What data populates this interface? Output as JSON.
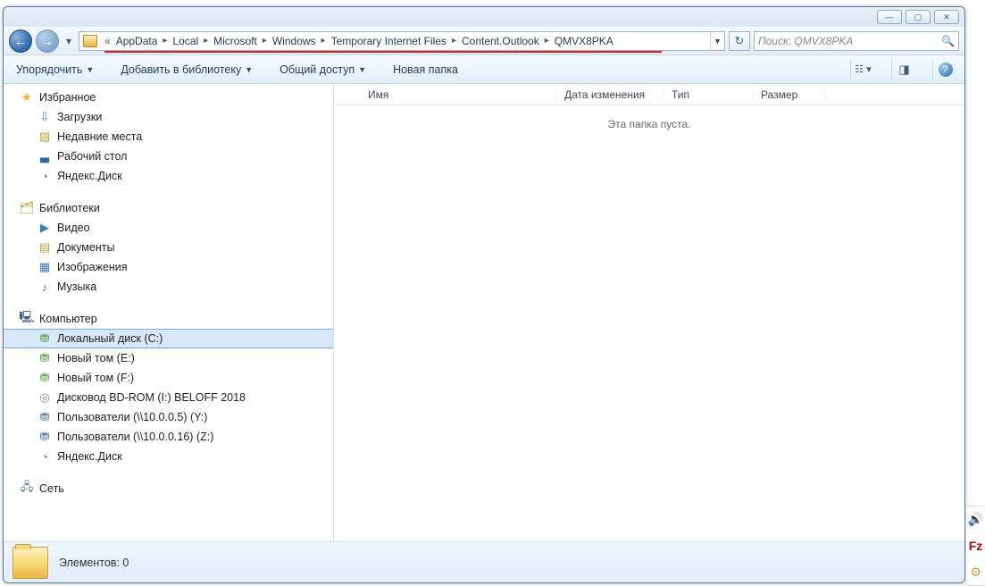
{
  "breadcrumbs": {
    "prefix": "«",
    "items": [
      "AppData",
      "Local",
      "Microsoft",
      "Windows",
      "Temporary Internet Files",
      "Content.Outlook",
      "QMVX8PKA"
    ]
  },
  "search": {
    "placeholder": "Поиск: QMVX8PKA"
  },
  "commands": {
    "organize": "Упорядочить",
    "addToLibrary": "Добавить в библиотеку",
    "share": "Общий доступ",
    "newFolder": "Новая папка"
  },
  "sidebar": {
    "favorites": {
      "label": "Избранное",
      "items": [
        {
          "label": "Загрузки",
          "icon": "⇩",
          "cls": "dl"
        },
        {
          "label": "Недавние места",
          "icon": "▧",
          "cls": "doc"
        },
        {
          "label": "Рабочий стол",
          "icon": "▃",
          "cls": "desk"
        },
        {
          "label": "Яндекс.Диск",
          "icon": "◔",
          "cls": "ydisk"
        }
      ]
    },
    "libraries": {
      "label": "Библиотеки",
      "items": [
        {
          "label": "Видео",
          "icon": "▶",
          "cls": "vid"
        },
        {
          "label": "Документы",
          "icon": "▤",
          "cls": "doc"
        },
        {
          "label": "Изображения",
          "icon": "▦",
          "cls": "img"
        },
        {
          "label": "Музыка",
          "icon": "♪",
          "cls": "mus"
        }
      ]
    },
    "computer": {
      "label": "Компьютер",
      "items": [
        {
          "label": "Локальный диск (C:)",
          "icon": "⛃",
          "cls": "drive",
          "selected": true
        },
        {
          "label": "Новый том (E:)",
          "icon": "⛃",
          "cls": "drive"
        },
        {
          "label": "Новый том (F:)",
          "icon": "⛃",
          "cls": "drive"
        },
        {
          "label": "Дисковод BD-ROM (I:) BELOFF 2018",
          "icon": "◎",
          "cls": "bd"
        },
        {
          "label": "Пользователи (\\\\10.0.0.5) (Y:)",
          "icon": "⛃",
          "cls": "share"
        },
        {
          "label": "Пользователи (\\\\10.0.0.16) (Z:)",
          "icon": "⛃",
          "cls": "share"
        },
        {
          "label": "Яндекс.Диск",
          "icon": "◔",
          "cls": "ydisk"
        }
      ]
    },
    "network": {
      "label": "Сеть"
    }
  },
  "columns": {
    "name": "Имя",
    "date": "Дата изменения",
    "type": "Тип",
    "size": "Размер"
  },
  "content": {
    "emptyMessage": "Эта папка пуста."
  },
  "status": {
    "text": "Элементов: 0"
  }
}
